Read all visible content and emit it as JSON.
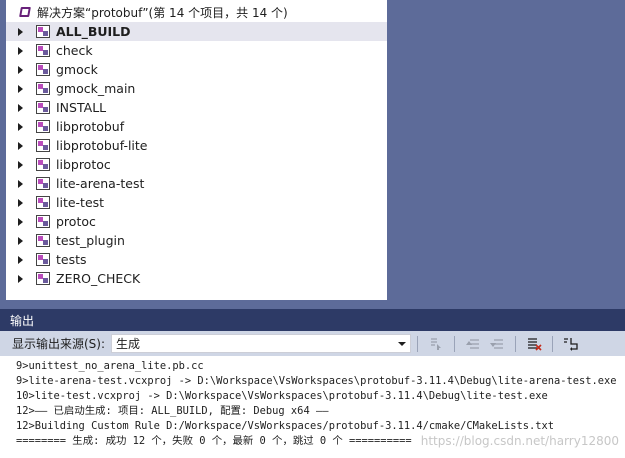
{
  "solution": {
    "title": "解决方案“protobuf”(第 14 个项目，共 14 个)"
  },
  "projects": [
    {
      "name": "ALL_BUILD",
      "selected": true
    },
    {
      "name": "check"
    },
    {
      "name": "gmock"
    },
    {
      "name": "gmock_main"
    },
    {
      "name": "INSTALL"
    },
    {
      "name": "libprotobuf"
    },
    {
      "name": "libprotobuf-lite"
    },
    {
      "name": "libprotoc"
    },
    {
      "name": "lite-arena-test"
    },
    {
      "name": "lite-test"
    },
    {
      "name": "protoc"
    },
    {
      "name": "test_plugin"
    },
    {
      "name": "tests"
    },
    {
      "name": "ZERO_CHECK"
    }
  ],
  "output": {
    "tab_title": "输出",
    "source_label": "显示输出来源(S):",
    "source_value": "生成",
    "lines": [
      "9>unittest_no_arena_lite.pb.cc",
      "9>lite-arena-test.vcxproj -> D:\\Workspace\\VsWorkspaces\\protobuf-3.11.4\\Debug\\lite-arena-test.exe",
      "10>lite-test.vcxproj -> D:\\Workspace\\VsWorkspaces\\protobuf-3.11.4\\Debug\\lite-test.exe",
      "12>—— 已启动生成: 项目: ALL_BUILD, 配置: Debug x64 ——",
      "12>Building Custom Rule D:/Workspace/VsWorkspaces/protobuf-3.11.4/cmake/CMakeLists.txt",
      "======== 生成: 成功 12 个，失败 0 个，最新 0 个，跳过 0 个 =========="
    ],
    "watermark": "https://blog.csdn.net/harry12800"
  },
  "icons": {
    "solution": "visual-studio-solution-icon",
    "project": "cpp-project-icon",
    "expand": "expand-caret-icon"
  }
}
